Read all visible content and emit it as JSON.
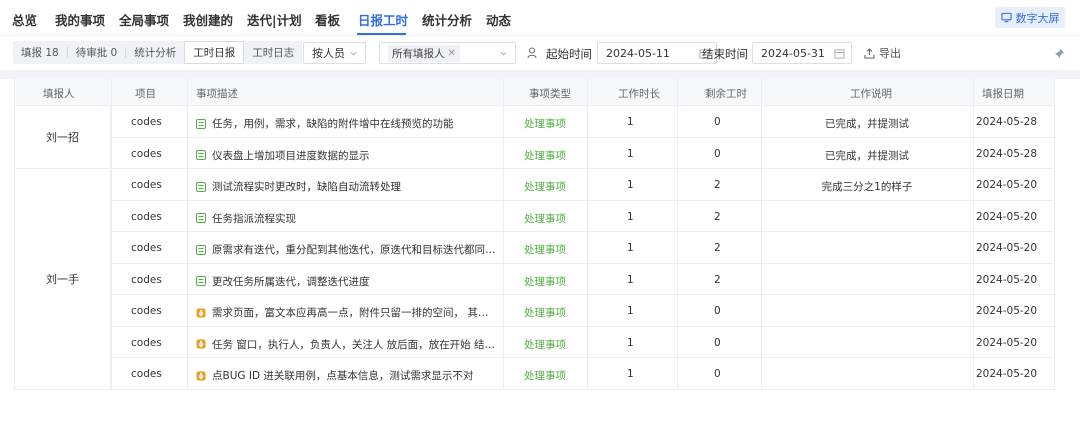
{
  "nav": {
    "items": [
      "总览",
      "我的事项",
      "全局事项",
      "我创建的",
      "迭代|计划",
      "看板",
      "日报工时",
      "统计分析",
      "动态"
    ],
    "active_index": 6,
    "bigscreen_label": "数字大屏"
  },
  "filters": {
    "segments": [
      "填报 18",
      "待审批 0",
      "统计分析",
      "工时日报",
      "工时日志"
    ],
    "group_by": "按人员",
    "reporter_tag": "所有填报人",
    "start_label": "起始时间",
    "start_date": "2024-05-11",
    "end_label": "结束时间",
    "end_date": "2024-05-31",
    "export_label": "导出"
  },
  "table": {
    "headers": [
      "填报人",
      "项目",
      "事项描述",
      "事项类型",
      "工作时长",
      "剩余工时",
      "工作说明",
      "填报日期"
    ],
    "groups": [
      {
        "reporter": "刘一招",
        "rows": 2
      },
      {
        "reporter": "刘一手",
        "rows": 7
      }
    ],
    "rows": [
      {
        "project": "codes",
        "icon": "task-icon",
        "desc": "任务，用例，需求，缺陷的附件增中在线预览的功能",
        "type": "处理事项",
        "hours": "1",
        "remaining": "0",
        "note": "已完成，并提测试",
        "date": "2024-05-28"
      },
      {
        "project": "codes",
        "icon": "task-icon",
        "desc": "仪表盘上增加项目进度数据的显示",
        "type": "处理事项",
        "hours": "1",
        "remaining": "0",
        "note": "已完成，并提测试",
        "date": "2024-05-28"
      },
      {
        "project": "codes",
        "icon": "task-icon",
        "desc": "测试流程实时更改时，缺陷自动流转处理",
        "type": "处理事项",
        "hours": "1",
        "remaining": "2",
        "note": "完成三分之1的样子",
        "date": "2024-05-20"
      },
      {
        "project": "codes",
        "icon": "task-icon",
        "desc": "任务指派流程实现",
        "type": "处理事项",
        "hours": "1",
        "remaining": "2",
        "note": "",
        "date": "2024-05-20"
      },
      {
        "project": "codes",
        "icon": "task-icon",
        "desc": "原需求有迭代，重分配到其他迭代，原迭代和目标迭代都同步调...",
        "type": "处理事项",
        "hours": "1",
        "remaining": "2",
        "note": "",
        "date": "2024-05-20"
      },
      {
        "project": "codes",
        "icon": "task-icon",
        "desc": "更改任务所属迭代，调整迭代进度",
        "type": "处理事项",
        "hours": "1",
        "remaining": "2",
        "note": "",
        "date": "2024-05-20"
      },
      {
        "project": "codes",
        "icon": "bug-icon",
        "desc": "需求页面，富文本应再高一点，附件只留一排的空间， 其他的给...",
        "type": "处理事项",
        "hours": "1",
        "remaining": "0",
        "note": "",
        "date": "2024-05-20"
      },
      {
        "project": "codes",
        "icon": "bug-icon",
        "desc": "任务 窗口，执行人，负责人，关注人 放后面，放在开始 结束日...",
        "type": "处理事项",
        "hours": "1",
        "remaining": "0",
        "note": "",
        "date": "2024-05-20"
      },
      {
        "project": "codes",
        "icon": "bug-icon",
        "desc": "点BUG ID 进关联用例，点基本信息，测试需求显示不对",
        "type": "处理事项",
        "hours": "1",
        "remaining": "0",
        "note": "",
        "date": "2024-05-20"
      }
    ]
  },
  "colors": {
    "accent": "#2f6fe4",
    "type_green": "#52b043",
    "task_icon": "#52b043",
    "bug_icon": "#f0a020"
  }
}
